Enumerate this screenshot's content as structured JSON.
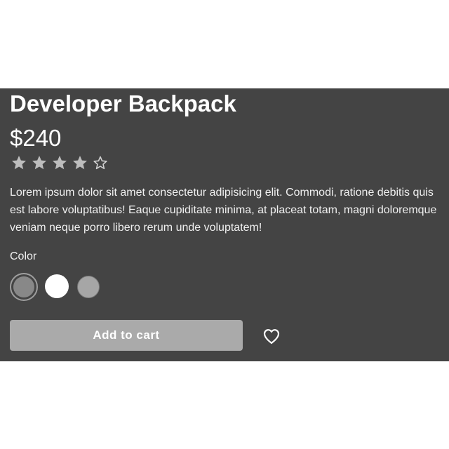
{
  "product": {
    "title": "Developer Backpack",
    "price": "$240",
    "rating": 4,
    "rating_max": 5,
    "description": "Lorem ipsum dolor sit amet consectetur adipisicing elit. Commodi, ratione debitis quis est labore voluptatibus! Eaque cupiditate minima, at placeat totam, magni doloremque veniam neque porro libero rerum unde voluptatem!",
    "color_label": "Color",
    "colors": [
      "#888888",
      "#ffffff",
      "#a6a6a6"
    ],
    "selected_color": "#888888"
  },
  "actions": {
    "add_to_cart_label": "Add to cart",
    "favorite_icon": "heart-outline-icon"
  },
  "theme": {
    "card_background": "#444444",
    "button_background": "#aaaaaa",
    "text": "#ffffff"
  }
}
